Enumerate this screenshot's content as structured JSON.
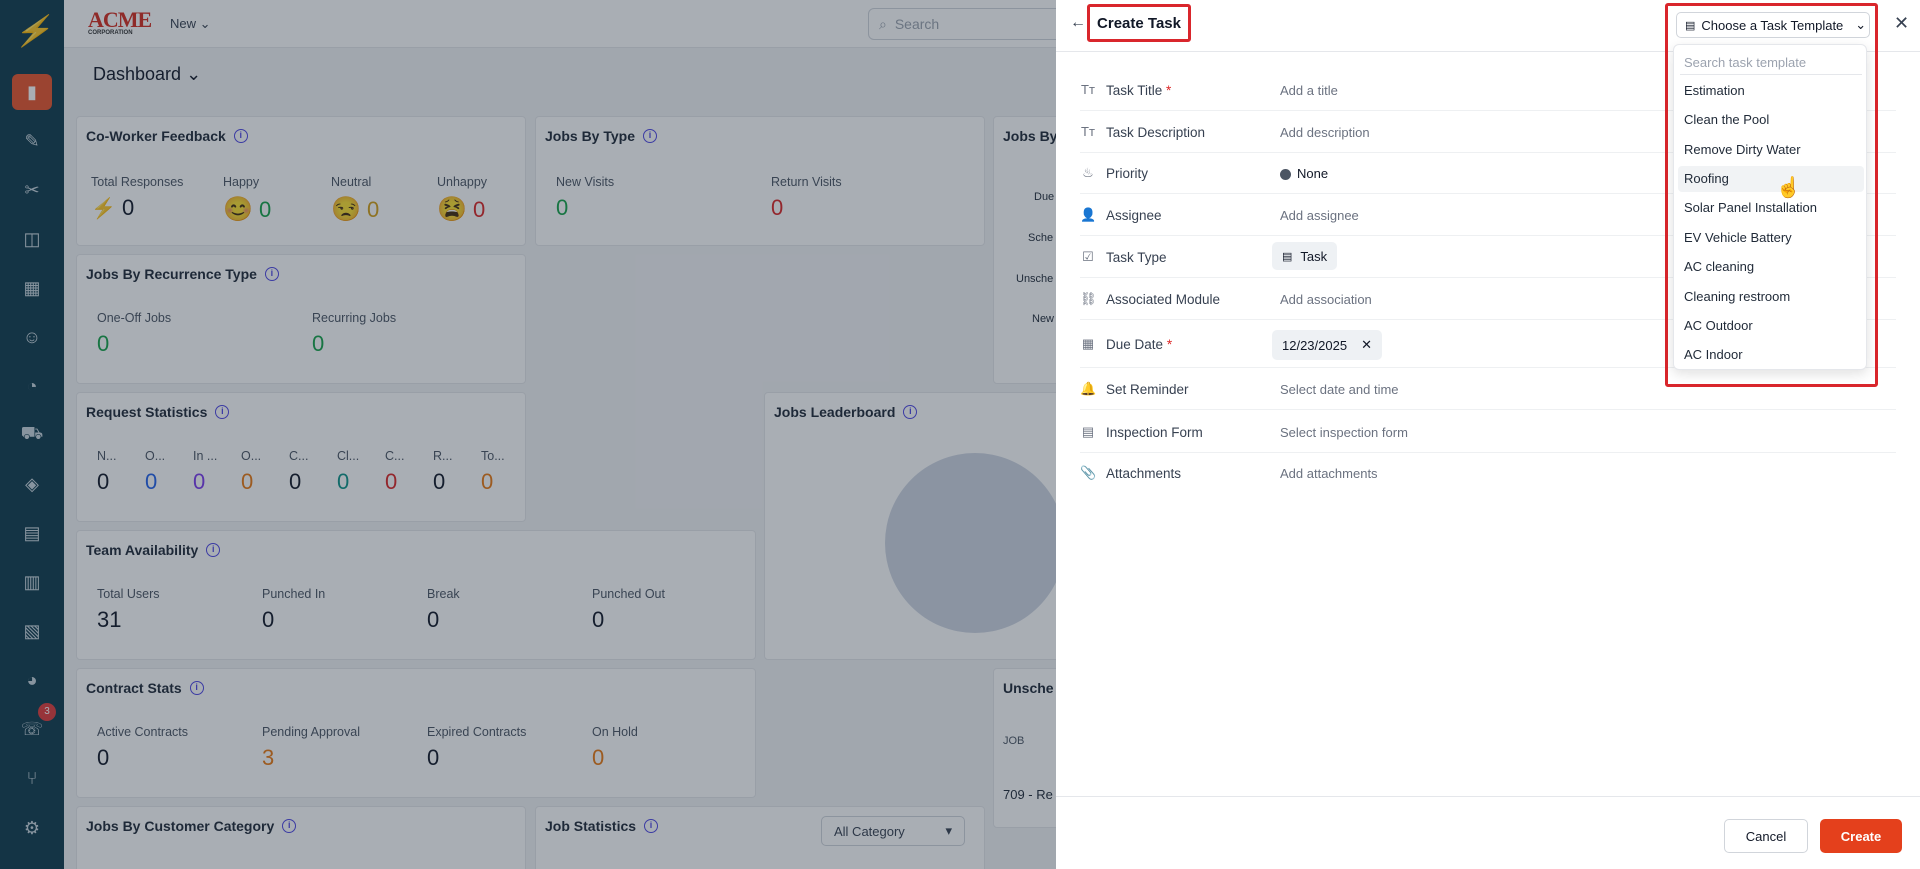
{
  "sidebar": {
    "badge": "3"
  },
  "topbar": {
    "brand": "ACME",
    "brand_sub": "CORPORATION",
    "new_label": "New",
    "search_placeholder": "Search"
  },
  "dashboard": {
    "title": "Dashboard",
    "coworker": {
      "title": "Co-Worker Feedback",
      "total_label": "Total Responses",
      "total": "0",
      "happy_label": "Happy",
      "happy": "0",
      "neutral_label": "Neutral",
      "neutral": "0",
      "unhappy_label": "Unhappy",
      "unhappy": "0"
    },
    "jobs_by_type": {
      "title": "Jobs By Type",
      "new_label": "New Visits",
      "new": "0",
      "return_label": "Return Visits",
      "return": "0"
    },
    "jobs_by_partial": {
      "title": "Jobs By",
      "labels": [
        "Due",
        "Sche",
        "Unsche",
        "New"
      ]
    },
    "recurrence": {
      "title": "Jobs By Recurrence Type",
      "oneoff_label": "One-Off Jobs",
      "oneoff": "0",
      "recurring_label": "Recurring Jobs",
      "recurring": "0"
    },
    "request_stats": {
      "title": "Request Statistics",
      "items": [
        {
          "label": "N...",
          "value": "0"
        },
        {
          "label": "O...",
          "value": "0"
        },
        {
          "label": "In ...",
          "value": "0"
        },
        {
          "label": "O...",
          "value": "0"
        },
        {
          "label": "C...",
          "value": "0"
        },
        {
          "label": "Cl...",
          "value": "0"
        },
        {
          "label": "C...",
          "value": "0"
        },
        {
          "label": "R...",
          "value": "0"
        },
        {
          "label": "To...",
          "value": "0"
        }
      ]
    },
    "leaderboard": {
      "title": "Jobs Leaderboard"
    },
    "team": {
      "title": "Team Availability",
      "total_label": "Total Users",
      "total": "31",
      "in_label": "Punched In",
      "in": "0",
      "break_label": "Break",
      "break": "0",
      "out_label": "Punched Out",
      "out": "0"
    },
    "contracts": {
      "title": "Contract Stats",
      "active_label": "Active Contracts",
      "active": "0",
      "pending_label": "Pending Approval",
      "pending": "3",
      "expired_label": "Expired Contracts",
      "expired": "0",
      "hold_label": "On Hold",
      "hold": "0"
    },
    "unscheduled": {
      "title": "Unsche",
      "col": "JOB",
      "row": "709 - Re"
    },
    "customer_category": {
      "title": "Jobs By Customer Category"
    },
    "job_statistics": {
      "title": "Job Statistics",
      "filter": "All Category"
    }
  },
  "panel": {
    "title": "Create Task",
    "template_button": "Choose a Task Template",
    "fields": {
      "title": {
        "label": "Task Title",
        "required": "*",
        "placeholder": "Add a title"
      },
      "description": {
        "label": "Task Description",
        "placeholder": "Add description"
      },
      "priority": {
        "label": "Priority",
        "value": "None"
      },
      "assignee": {
        "label": "Assignee",
        "placeholder": "Add assignee"
      },
      "type": {
        "label": "Task Type",
        "value": "Task"
      },
      "module": {
        "label": "Associated Module",
        "placeholder": "Add association"
      },
      "due": {
        "label": "Due Date",
        "required": "*",
        "value": "12/23/2025"
      },
      "reminder": {
        "label": "Set Reminder",
        "placeholder": "Select date and time"
      },
      "inspection": {
        "label": "Inspection Form",
        "placeholder": "Select inspection form"
      },
      "attachments": {
        "label": "Attachments",
        "placeholder": "Add attachments"
      }
    },
    "cancel": "Cancel",
    "create": "Create"
  },
  "dropdown": {
    "search_placeholder": "Search task template",
    "items": [
      "Estimation",
      "Clean the Pool",
      "Remove Dirty Water",
      "Roofing",
      "Solar Panel Installation",
      "EV Vehicle Battery",
      "AC cleaning",
      "Cleaning restroom",
      "AC Outdoor",
      "AC Indoor"
    ],
    "hovered": "Roofing"
  },
  "colors": {
    "accent": "#e4401c",
    "sidebar": "#0f3a4c",
    "highlight": "#d9262c"
  }
}
